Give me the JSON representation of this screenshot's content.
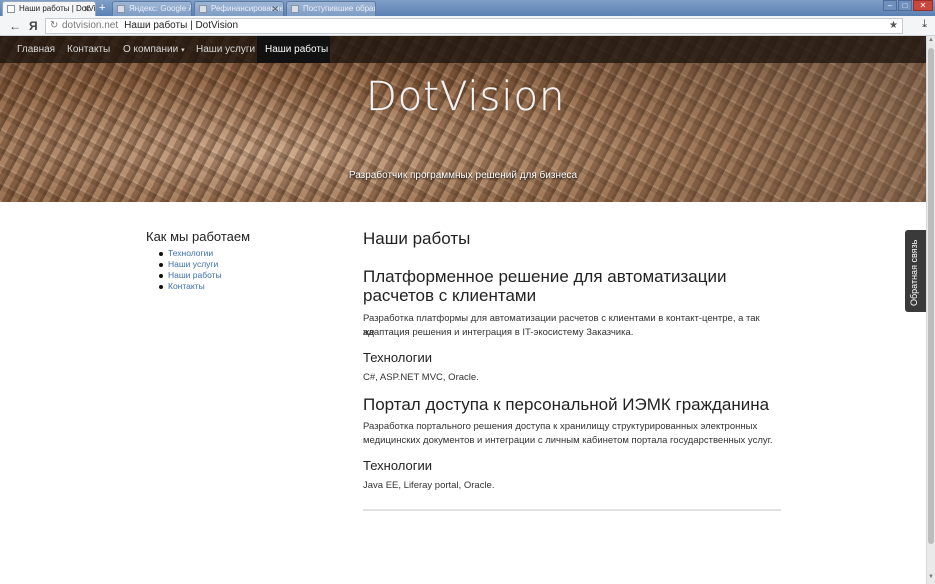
{
  "browser": {
    "tabs": [
      {
        "title": "Наши работы | DotVision",
        "active": true
      },
      {
        "title": "Яндекс: Google Аналитика",
        "active": false
      },
      {
        "title": "Рефинансирование Минск",
        "active": false
      },
      {
        "title": "Поступившие обращения",
        "active": false
      }
    ],
    "new_tab_symbol": "+",
    "window_buttons": {
      "minimize": "–",
      "maximize": "□",
      "close": "✕"
    },
    "back_symbol": "←",
    "yandex_symbol": "Я",
    "reload_symbol": "↻",
    "url_domain": "dotvision.net",
    "url_title": "Наши работы | DotVision",
    "star_symbol": "★",
    "download_symbol": "⤓"
  },
  "nav": {
    "items": [
      {
        "label": "Главная",
        "active": false
      },
      {
        "label": "Контакты",
        "active": false
      },
      {
        "label": "О компании",
        "active": false,
        "dropdown": true
      },
      {
        "label": "Наши услуги",
        "active": false
      },
      {
        "label": "Наши работы",
        "active": true
      }
    ],
    "caret": "▾"
  },
  "hero": {
    "brand": "DotVision",
    "tagline": "Разработчик программных решений для бизнеса"
  },
  "sidebar": {
    "title": "Как мы работаем",
    "links": [
      "Технологии",
      "Наши услуги",
      "Наши работы",
      "Контакты"
    ]
  },
  "main": {
    "title": "Наши работы",
    "projects": [
      {
        "title_line1": "Платформенное решение для автоматизации",
        "title_line2": "расчетов с клиентами",
        "description_line1": "Разработка платформы для автоматизации расчетов с клиентами в контакт-центре, а так же",
        "description_line2": "адаптация решения и интеграция в IT-экосистему Заказчика.",
        "tech_heading": "Технологии",
        "tech": "C#, ASP.NET MVC, Oracle."
      },
      {
        "title_line1": "Портал доступа к персональной ИЭМК гражданина",
        "description_line1": "Разработка портального решения доступа к хранилищу структурированных электронных",
        "description_line2": "медицинских документов и интеграции с личным кабинетом портала государственных услуг.",
        "tech_heading": "Технологии",
        "tech": "Java EE, Liferay portal, Oracle."
      }
    ]
  },
  "feedback": {
    "label": "Обратная связь"
  },
  "colors": {
    "link": "#3c6fb0",
    "navbar": "#1e140e",
    "feedback": "#3a3a3a"
  }
}
